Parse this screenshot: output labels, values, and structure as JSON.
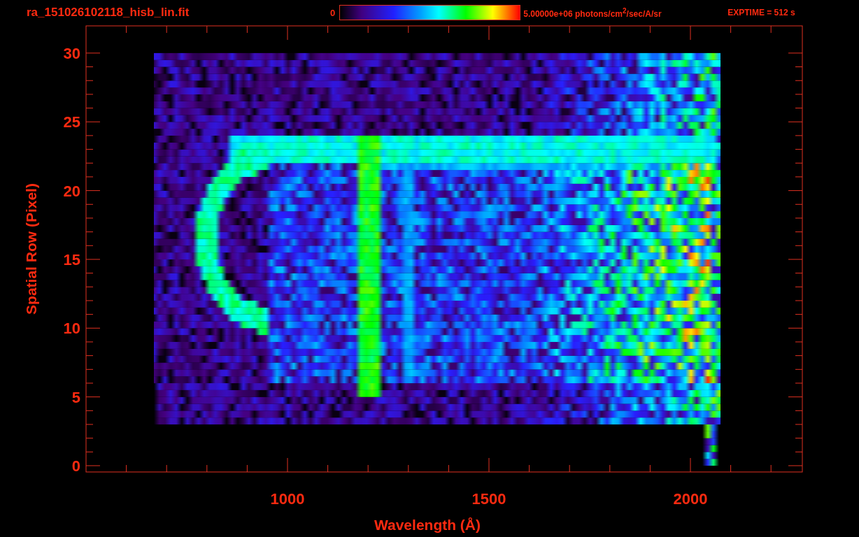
{
  "header": {
    "filename": "ra_151026102118_hisb_lin.fit",
    "colorbar": {
      "min_label": "0",
      "max_label": "5.00000e+06 photons/cm$^{2}$/sec/A/sr"
    },
    "exposure": "EXPTIME = 512 s"
  },
  "plot": {
    "ylabel": "Spatial Row (Pixel)",
    "yticks": [
      "30",
      "25",
      "20",
      "15",
      "10",
      "5",
      "0"
    ],
    "xlabel": "Wavelength (Å)",
    "xticks": [
      "1000",
      "1500",
      "2000"
    ]
  }
}
